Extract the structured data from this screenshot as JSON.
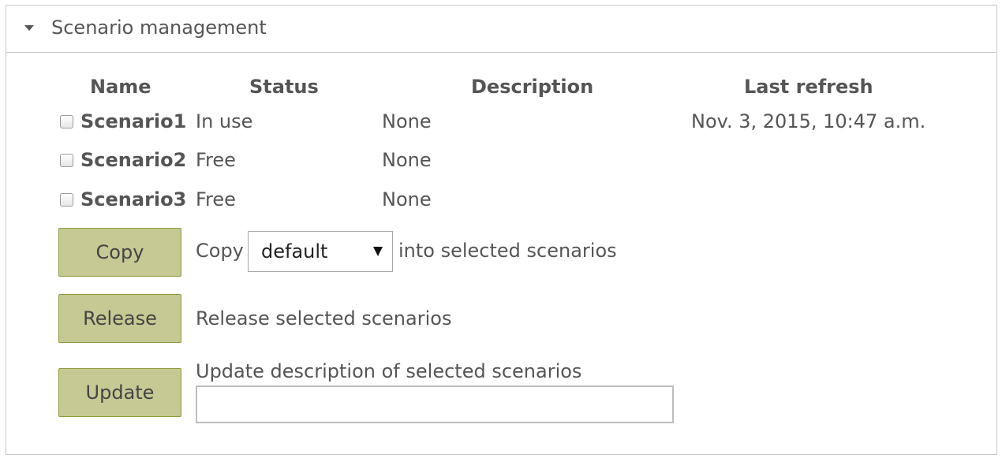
{
  "panel": {
    "title": "Scenario management"
  },
  "table": {
    "headers": {
      "name": "Name",
      "status": "Status",
      "description": "Description",
      "last_refresh": "Last refresh"
    },
    "rows": [
      {
        "name": "Scenario1",
        "status": "In use",
        "description": "None",
        "last_refresh": "Nov. 3, 2015, 10:47 a.m."
      },
      {
        "name": "Scenario2",
        "status": "Free",
        "description": "None",
        "last_refresh": ""
      },
      {
        "name": "Scenario3",
        "status": "Free",
        "description": "None",
        "last_refresh": ""
      }
    ]
  },
  "actions": {
    "copy": {
      "button_label": "Copy",
      "prefix": "Copy",
      "selected_value": "default",
      "suffix": "into selected scenarios"
    },
    "release": {
      "button_label": "Release",
      "text": "Release selected scenarios"
    },
    "update": {
      "button_label": "Update",
      "text": "Update description of selected scenarios",
      "input_value": ""
    }
  },
  "colors": {
    "button_bg": "#c6c994",
    "button_border": "#8e9b3d",
    "text": "#555555"
  }
}
